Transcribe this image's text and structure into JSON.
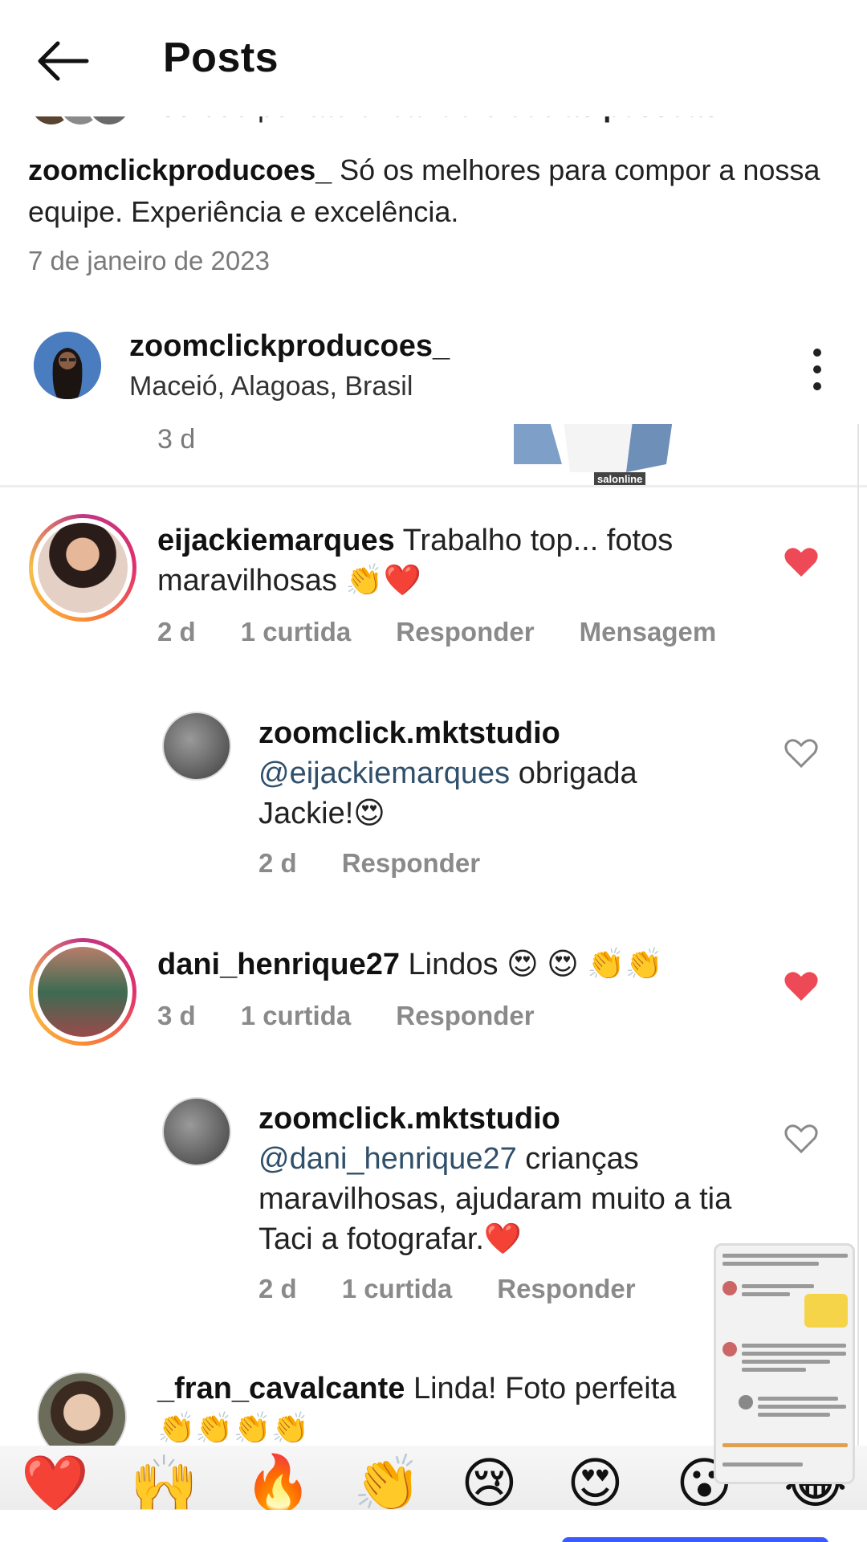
{
  "header": {
    "title": "Posts"
  },
  "liked_by": {
    "prefix": "Curtido por",
    "user": "tacielicando",
    "joiner": "e",
    "others": "outras pessoas"
  },
  "caption": {
    "username": "zoomclickproducoes_",
    "text": "Só os melhores para compor a nossa equipe. Experiência e excelência."
  },
  "post_date": "7 de janeiro de 2023",
  "post_header": {
    "username": "zoomclickproducoes_",
    "location": "Maceió, Alagoas, Brasil"
  },
  "screenshot": {
    "top_time": "3 d",
    "watermark": "salonline",
    "comments": [
      {
        "username": "eijackiemarques",
        "text": "Trabalho top... fotos maravilhosas 👏❤️",
        "meta": [
          "2 d",
          "1 curtida",
          "Responder",
          "Mensagem"
        ],
        "liked": true
      },
      {
        "username": "zoomclick.mktstudio",
        "mention": "@eijackiemarques",
        "text": "obrigada Jackie!😍",
        "meta": [
          "2 d",
          "Responder"
        ],
        "liked": false
      },
      {
        "username": "dani_henrique27",
        "text": "Lindos 😍 😍 👏👏",
        "meta": [
          "3 d",
          "1 curtida",
          "Responder"
        ],
        "liked": true
      },
      {
        "username": "zoomclick.mktstudio",
        "mention": "@dani_henrique27",
        "text": "crianças maravilhosas, ajudaram muito a tia Taci a fotografar.❤️",
        "meta": [
          "2 d",
          "1 curtida",
          "Responder"
        ],
        "liked": false
      },
      {
        "username": "_fran_cavalcante",
        "text": "Linda! Foto perfeita",
        "emoji_line": "👏👏👏👏"
      }
    ],
    "emoji_bar": [
      "❤️",
      "🙌",
      "🔥",
      "👏",
      "😢",
      "😍",
      "😮",
      "😂"
    ]
  },
  "colors": {
    "heart_red": "#ed4956",
    "mention_blue": "#2f4f6a",
    "meta_gray": "#8a8a8a",
    "bottom_pill": "#3d5afe"
  },
  "icons": {
    "back": "arrow-left",
    "more": "vertical-ellipsis",
    "like": "heart"
  }
}
